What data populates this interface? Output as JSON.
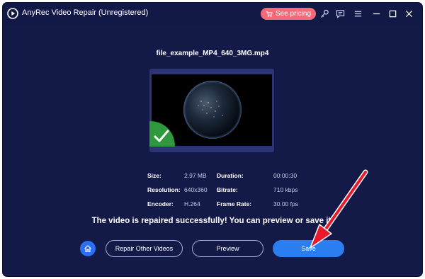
{
  "window": {
    "title": "AnyRec Video Repair (Unregistered)",
    "see_pricing_label": "See pricing",
    "icons": [
      "app-logo-icon",
      "cart-icon",
      "key-icon",
      "feedback-icon",
      "menu-icon",
      "minimize-icon",
      "maximize-icon",
      "close-icon"
    ]
  },
  "video": {
    "filename": "file_example_MP4_640_3MG.mp4",
    "status_icon": "check-icon"
  },
  "info": {
    "size_label": "Size:",
    "size_value": "2.97 MB",
    "resolution_label": "Resolution:",
    "resolution_value": "640x360",
    "encoder_label": "Encoder:",
    "encoder_value": "H.264",
    "duration_label": "Duration:",
    "duration_value": "00:00:30",
    "bitrate_label": "Bitrate:",
    "bitrate_value": "710 kbps",
    "framerate_label": "Frame Rate:",
    "framerate_value": "30.00 fps"
  },
  "message": "The video is repaired successfully! You can preview or save it.",
  "buttons": {
    "home_icon": "home-icon",
    "repair_other_label": "Repair Other Videos",
    "preview_label": "Preview",
    "save_label": "Save"
  },
  "annotation": {
    "arrow_color": "#e8192c"
  },
  "colors": {
    "background": "#141a48",
    "accent": "#2b7ef0",
    "pricing": "#f46a78",
    "success": "#2e9a3c"
  }
}
